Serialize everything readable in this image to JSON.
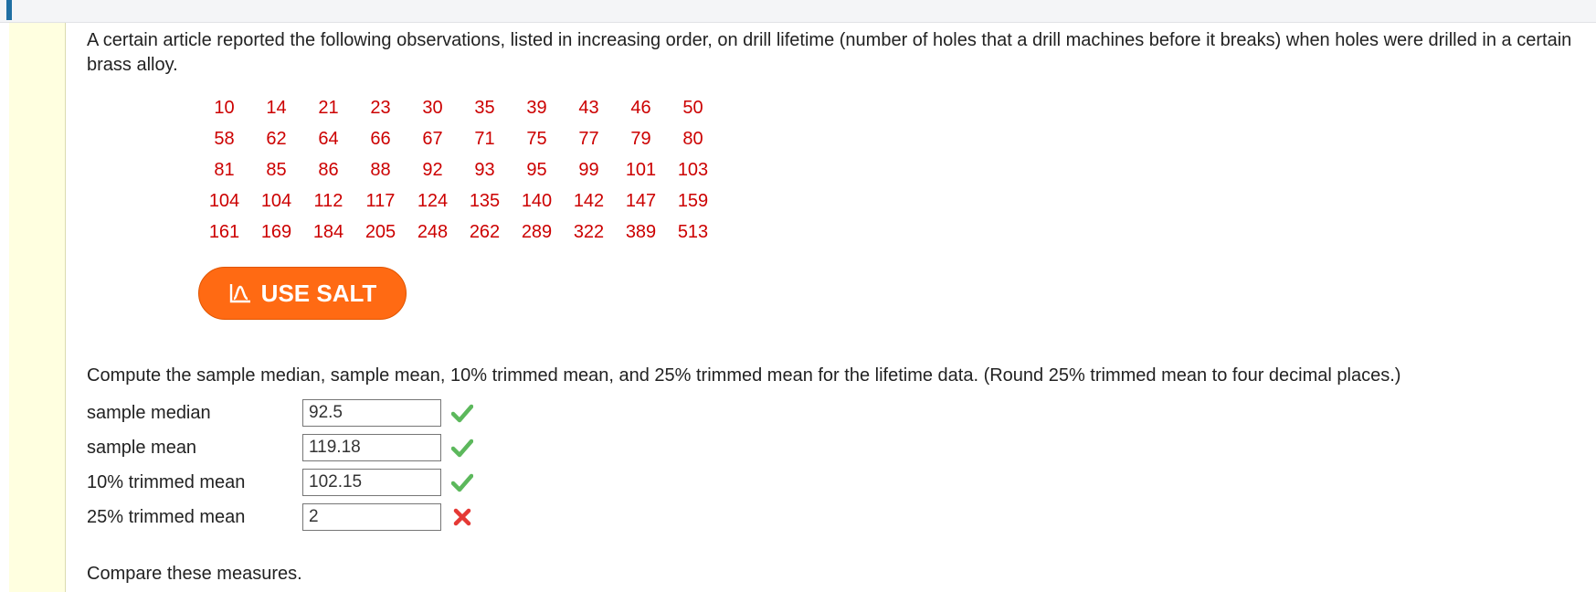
{
  "intro_text": "A certain article reported the following observations, listed in increasing order, on drill lifetime (number of holes that a drill machines before it breaks) when holes were drilled in a certain brass alloy.",
  "data_rows": [
    [
      "10",
      "14",
      "21",
      "23",
      "30",
      "35",
      "39",
      "43",
      "46",
      "50"
    ],
    [
      "58",
      "62",
      "64",
      "66",
      "67",
      "71",
      "75",
      "77",
      "79",
      "80"
    ],
    [
      "81",
      "85",
      "86",
      "88",
      "92",
      "93",
      "95",
      "99",
      "101",
      "103"
    ],
    [
      "104",
      "104",
      "112",
      "117",
      "124",
      "135",
      "140",
      "142",
      "147",
      "159"
    ],
    [
      "161",
      "169",
      "184",
      "205",
      "248",
      "262",
      "289",
      "322",
      "389",
      "513"
    ]
  ],
  "salt_button": {
    "label": "USE SALT",
    "icon": "salt-chart-icon",
    "color": "#ff6a13"
  },
  "question_text": "Compute the sample median, sample mean, 10% trimmed mean, and 25% trimmed mean for the lifetime data. (Round 25% trimmed mean to four decimal places.)",
  "answers": [
    {
      "label": "sample median",
      "value": "92.5",
      "status": "correct"
    },
    {
      "label": "sample mean",
      "value": "119.18",
      "status": "correct"
    },
    {
      "label": "10% trimmed mean",
      "value": "102.15",
      "status": "correct"
    },
    {
      "label": "25% trimmed mean",
      "value": "2",
      "status": "incorrect"
    }
  ],
  "status_colors": {
    "correct": "#5cb85c",
    "incorrect": "#e53935",
    "data_text": "#cc0000"
  },
  "compare_text": "Compare these measures."
}
